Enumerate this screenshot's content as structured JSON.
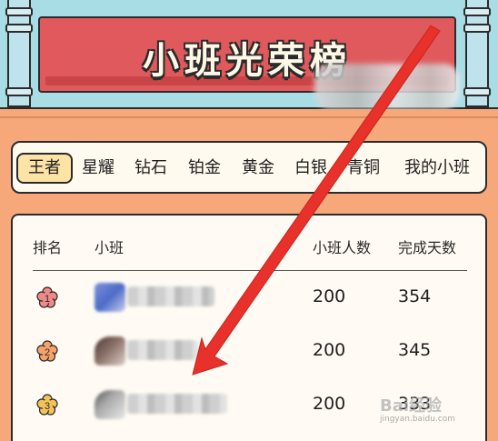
{
  "banner": {
    "title": "小班光荣榜"
  },
  "tabs": [
    {
      "label": "王者",
      "active": true
    },
    {
      "label": "星耀",
      "active": false
    },
    {
      "label": "钻石",
      "active": false
    },
    {
      "label": "铂金",
      "active": false
    },
    {
      "label": "黄金",
      "active": false
    },
    {
      "label": "白银",
      "active": false
    },
    {
      "label": "青铜",
      "active": false
    },
    {
      "label": "我的小班",
      "active": false
    }
  ],
  "table": {
    "headers": {
      "rank": "排名",
      "class": "小班",
      "members": "小班人数",
      "days": "完成天数"
    },
    "rows": [
      {
        "rank": "1",
        "members": "200",
        "days": "354",
        "badge_color": "#f08a8a"
      },
      {
        "rank": "2",
        "members": "200",
        "days": "345",
        "badge_color": "#f5a36a"
      },
      {
        "rank": "3",
        "members": "200",
        "days": "333",
        "badge_color": "#f3c35a"
      }
    ]
  },
  "watermark": {
    "text": "Bai经验",
    "sub": "jingyan.baidu.com"
  },
  "colors": {
    "annotation_arrow": "#e8312a",
    "banner": "#e05a5d",
    "active_tab": "#fde3a6"
  }
}
